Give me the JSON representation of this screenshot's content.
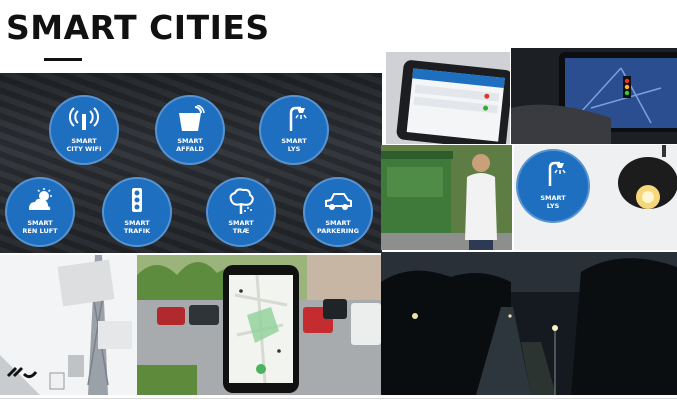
{
  "slide": {
    "title": "SMART CITIES"
  },
  "icons": [
    {
      "name": "wifi-icon",
      "lines": [
        "SMART",
        "CITY WIFI"
      ]
    },
    {
      "name": "trash-icon",
      "lines": [
        "SMART",
        "AFFALD"
      ]
    },
    {
      "name": "streetlight-icon",
      "lines": [
        "SMART",
        "LYS"
      ]
    },
    {
      "name": "weather-icon",
      "lines": [
        "SMART",
        "REN LUFT"
      ]
    },
    {
      "name": "traffic-light-icon",
      "lines": [
        "SMART",
        "TRAFIK"
      ]
    },
    {
      "name": "tree-icon",
      "lines": [
        "SMART",
        "TRÆ"
      ]
    },
    {
      "name": "car-icon",
      "lines": [
        "SMART",
        "PARKERING"
      ]
    }
  ],
  "lamp_panel_icon": {
    "name": "streetlight-icon",
    "lines": [
      "SMART",
      "LYS"
    ]
  },
  "colors": {
    "accent_blue": "#1f6fc1",
    "title": "#111111"
  }
}
